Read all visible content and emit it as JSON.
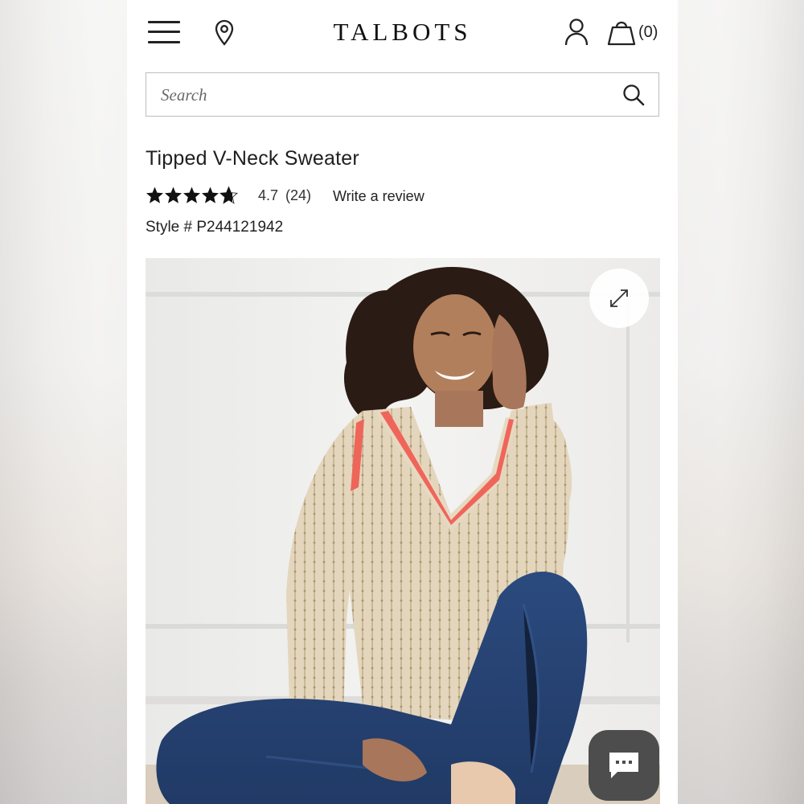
{
  "header": {
    "brand_logo": "TALBOTS",
    "icons": {
      "menu": "hamburger-menu-icon",
      "store_locator": "map-pin-icon",
      "account": "user-icon",
      "bag": "shopping-bag-icon"
    },
    "bag_count": "(0)"
  },
  "search": {
    "placeholder": "Search",
    "icon": "search-icon"
  },
  "product": {
    "title": "Tipped V-Neck Sweater",
    "rating": {
      "stars_out_of_5": 4.7,
      "value_text": "4.7",
      "count_text": "(24)"
    },
    "write_review_label": "Write a review",
    "style_number": "Style # P244121942"
  },
  "gallery": {
    "expand_icon": "expand-arrows-icon"
  },
  "chat": {
    "icon": "chat-bubble-icon"
  },
  "colors": {
    "sweater_cream": "#e6d9c2",
    "tipping_coral": "#f0655a",
    "denim_blue": "#2c4a7c",
    "chat_button_bg": "#4d4d4d"
  }
}
